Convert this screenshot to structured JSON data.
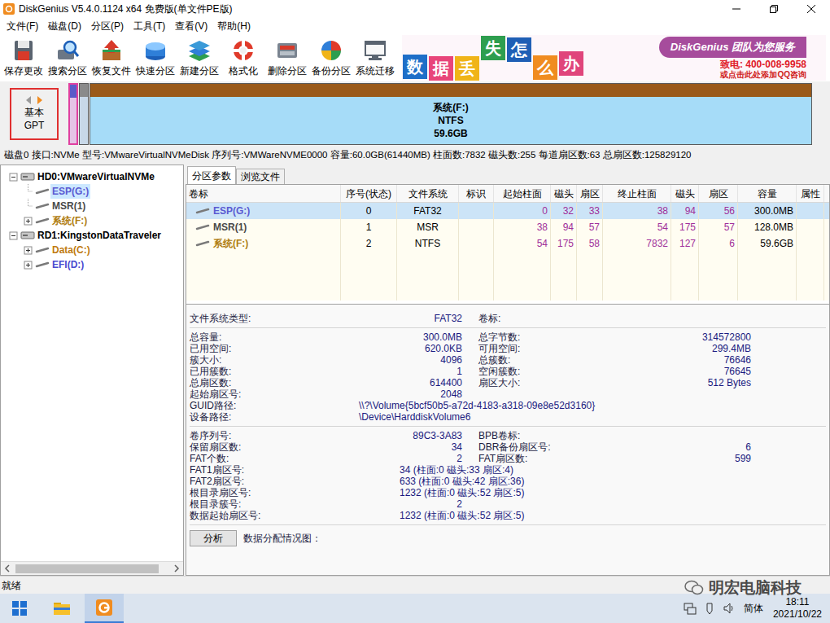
{
  "window": {
    "title": "DiskGenius V5.4.0.1124 x64 免费版(单文件PE版)"
  },
  "menu": [
    "文件(F)",
    "磁盘(D)",
    "分区(P)",
    "工具(T)",
    "查看(V)",
    "帮助(H)"
  ],
  "toolbar": [
    "保存更改",
    "搜索分区",
    "恢复文件",
    "快速分区",
    "新建分区",
    "格式化",
    "删除分区",
    "备份分区",
    "系统迁移"
  ],
  "banner": {
    "tiles": [
      {
        "text": "数",
        "color": "#1e6fc8"
      },
      {
        "text": "据",
        "color": "#e8457a"
      },
      {
        "text": "丢",
        "color": "#f0b418"
      },
      {
        "text": "失",
        "color": "#2e9e4f"
      },
      {
        "text": "怎",
        "color": "#1f5fb5"
      },
      {
        "text": "么",
        "color": "#f08c20"
      },
      {
        "text": "办",
        "color": "#e0457b"
      }
    ],
    "slogan": "DiskGenius 团队为您服务",
    "phone": "致电: 400-008-9958",
    "link": "或点击此处添加QQ咨询"
  },
  "disk_map": {
    "style": "基本",
    "type": "GPT",
    "partitions": [
      {
        "label": "",
        "fs": "",
        "size": "",
        "color": "#5a5ac8",
        "fill": "#e6c3e6",
        "selected": true
      },
      {
        "label": "",
        "fs": "",
        "size": "",
        "color": "#8a8a8a",
        "fill": "#c8d8e8",
        "selected": false
      },
      {
        "label": "系统(F:)",
        "fs": "NTFS",
        "size": "59.6GB",
        "color": "#9a5a1a",
        "fill": "#a6dcf8",
        "selected": false
      }
    ]
  },
  "disk_info": "磁盘0 接口:NVMe 型号:VMwareVirtualNVMeDisk 序列号:VMWareNVME0000 容量:60.0GB(61440MB) 柱面数:7832 磁头数:255 每道扇区数:63 总扇区数:125829120",
  "tree": [
    {
      "label": "HD0:VMwareVirtualNVMe",
      "level": 0,
      "kind": "disk",
      "expandable": true,
      "expanded": true,
      "selected": false,
      "color": "#000000"
    },
    {
      "label": "ESP(G:)",
      "level": 1,
      "kind": "partition",
      "expandable": false,
      "expanded": false,
      "selected": true,
      "color": "#5a5ad2"
    },
    {
      "label": "MSR(1)",
      "level": 1,
      "kind": "partition",
      "expandable": false,
      "expanded": false,
      "selected": false,
      "color": "#4a4a4a"
    },
    {
      "label": "系统(F:)",
      "level": 1,
      "kind": "partition",
      "expandable": true,
      "expanded": false,
      "selected": false,
      "color": "#b07d10"
    },
    {
      "label": "RD1:KingstonDataTraveler",
      "level": 0,
      "kind": "disk",
      "expandable": true,
      "expanded": true,
      "selected": false,
      "color": "#000000"
    },
    {
      "label": "Data(C:)",
      "level": 1,
      "kind": "partition",
      "expandable": true,
      "expanded": false,
      "selected": false,
      "color": "#c07b10"
    },
    {
      "label": "EFI(D:)",
      "level": 1,
      "kind": "partition",
      "expandable": true,
      "expanded": false,
      "selected": false,
      "color": "#4a4ad0"
    }
  ],
  "tabs": [
    {
      "label": "分区参数",
      "selected": true
    },
    {
      "label": "浏览文件",
      "selected": false
    }
  ],
  "table": {
    "columns": [
      "卷标",
      "序号(状态)",
      "文件系统",
      "标识",
      "起始柱面",
      "磁头",
      "扇区",
      "终止柱面",
      "磁头",
      "扇区",
      "容量",
      "属性"
    ],
    "rows": [
      {
        "cells": [
          "ESP(G:)",
          "0",
          "FAT32",
          "",
          "0",
          "32",
          "33",
          "38",
          "94",
          "56",
          "300.0MB",
          ""
        ],
        "selected": true,
        "color": "#5a5ad2"
      },
      {
        "cells": [
          "MSR(1)",
          "1",
          "MSR",
          "",
          "38",
          "94",
          "57",
          "54",
          "175",
          "57",
          "128.0MB",
          ""
        ],
        "selected": false,
        "color": "#4a4a4a"
      },
      {
        "cells": [
          "系统(F:)",
          "2",
          "NTFS",
          "",
          "54",
          "175",
          "58",
          "7832",
          "127",
          "6",
          "59.6GB",
          ""
        ],
        "selected": false,
        "color": "#b07d10"
      }
    ]
  },
  "details": {
    "sections": [
      {
        "rows": [
          {
            "kind": "pair",
            "label": "文件系统类型:",
            "value": "FAT32",
            "right": {
              "label": "卷标:",
              "value": ""
            }
          }
        ]
      },
      {
        "rows": [
          {
            "kind": "pair",
            "label": "总容量:",
            "value": "300.0MB",
            "right": {
              "label": "总字节数:",
              "value": "314572800"
            }
          },
          {
            "kind": "pair",
            "label": "已用空间:",
            "value": "620.0KB",
            "right": {
              "label": "可用空间:",
              "value": "299.4MB"
            }
          },
          {
            "kind": "pair",
            "label": "簇大小:",
            "value": "4096",
            "right": {
              "label": "总簇数:",
              "value": "76646"
            }
          },
          {
            "kind": "pair",
            "label": "已用簇数:",
            "value": "1",
            "right": {
              "label": "空闲簇数:",
              "value": "76645"
            }
          },
          {
            "kind": "pair",
            "label": "总扇区数:",
            "value": "614400",
            "right": {
              "label": "扇区大小:",
              "value": "512 Bytes"
            }
          },
          {
            "kind": "pair",
            "label": "起始扇区号:",
            "value": "2048"
          },
          {
            "kind": "wide",
            "label": "GUID路径:",
            "value": "\\\\?\\Volume{5bcf50b5-a72d-4183-a318-09e8e52d3160}"
          },
          {
            "kind": "wide",
            "label": "设备路径:",
            "value": "\\Device\\HarddiskVolume6"
          }
        ]
      },
      {
        "rows": [
          {
            "kind": "pair",
            "label": "卷序列号:",
            "value": "89C3-3A83",
            "right": {
              "label": "BPB卷标:",
              "value": ""
            }
          },
          {
            "kind": "pair",
            "label": "保留扇区数:",
            "value": "34",
            "right": {
              "label": "DBR备份扇区号:",
              "value": "6"
            }
          },
          {
            "kind": "pair",
            "label": "FAT个数:",
            "value": "2",
            "right": {
              "label": "FAT扇区数:",
              "value": "599"
            }
          },
          {
            "kind": "sector",
            "label": "FAT1扇区号:",
            "value": "34 (柱面:0 磁头:33 扇区:4)"
          },
          {
            "kind": "sector",
            "label": "FAT2扇区号:",
            "value": "633 (柱面:0 磁头:42 扇区:36)"
          },
          {
            "kind": "sector",
            "label": "根目录扇区号:",
            "value": "1232 (柱面:0 磁头:52 扇区:5)"
          },
          {
            "kind": "pair",
            "label": "根目录簇号:",
            "value": "2"
          },
          {
            "kind": "sector",
            "label": "数据起始扇区号:",
            "value": "1232 (柱面:0 磁头:52 扇区:5)"
          }
        ]
      }
    ]
  },
  "analysis": {
    "button": "分析",
    "label": "数据分配情况图："
  },
  "status_bar": "就绪",
  "watermark": "明宏电脑科技",
  "taskbar": {
    "apps": [
      {
        "kind": "start",
        "selected": false
      },
      {
        "kind": "explorer",
        "selected": false
      },
      {
        "kind": "diskgenius",
        "selected": true
      }
    ],
    "ime": "简体",
    "time": "18:11",
    "date": "2021/10/22"
  }
}
